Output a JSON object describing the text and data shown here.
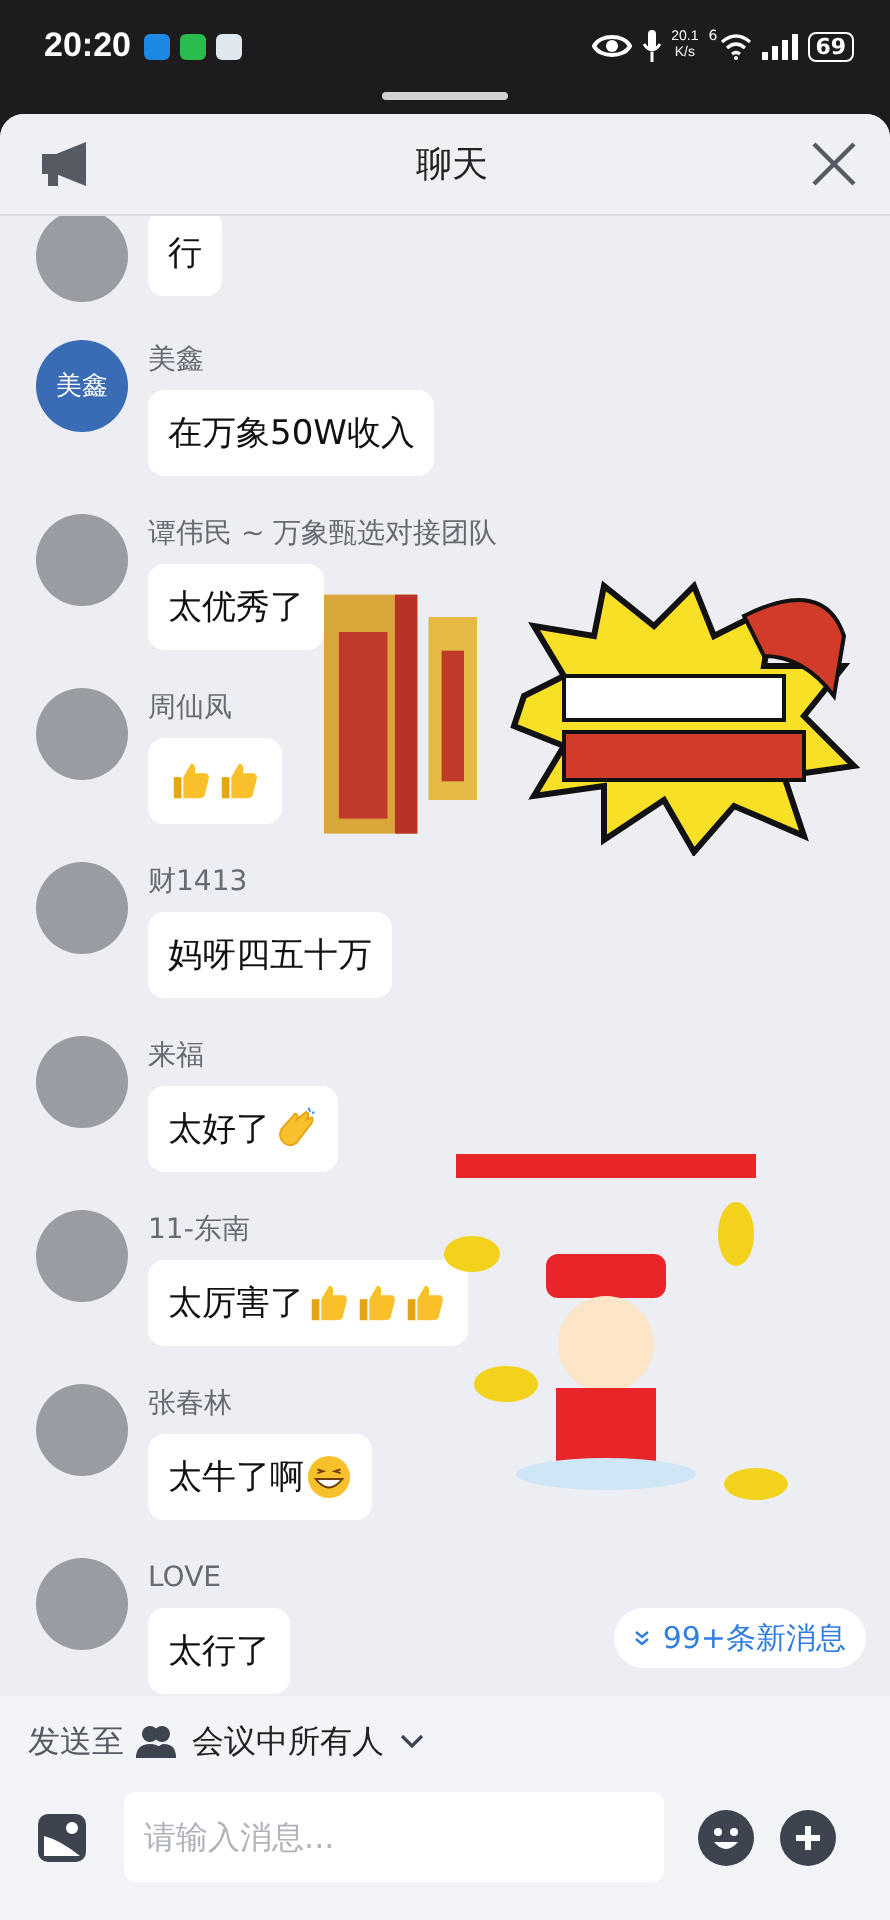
{
  "status_bar": {
    "time": "20:20",
    "net_speed_value": "20.1",
    "net_speed_unit": "K/s",
    "wifi_tag": "6",
    "battery": "69"
  },
  "header": {
    "title": "聊天"
  },
  "messages": [
    {
      "avatar": {
        "kind": "photo"
      },
      "text": "行"
    },
    {
      "sender": "美鑫",
      "avatar": {
        "kind": "initials",
        "text": "美鑫"
      },
      "text": "在万象50W收入"
    },
    {
      "sender": "谭伟民 ~ 万象甄选对接团队",
      "avatar": {
        "kind": "photo"
      },
      "text": "太优秀了"
    },
    {
      "sender": "周仙凤",
      "avatar": {
        "kind": "photo"
      },
      "emoji": [
        {
          "kind": "thumbs-up"
        },
        {
          "kind": "thumbs-up"
        }
      ]
    },
    {
      "sender": "财1413",
      "avatar": {
        "kind": "photo"
      },
      "text": "妈呀四五十万"
    },
    {
      "sender": "来福",
      "avatar": {
        "kind": "photo"
      },
      "text": "太好了",
      "emoji": [
        {
          "kind": "clap"
        }
      ]
    },
    {
      "sender": "11-东南",
      "avatar": {
        "kind": "photo"
      },
      "text": "太厉害了",
      "emoji": [
        {
          "kind": "thumbs-up"
        },
        {
          "kind": "thumbs-up"
        },
        {
          "kind": "thumbs-up"
        }
      ]
    },
    {
      "sender": "张春林",
      "avatar": {
        "kind": "photo"
      },
      "text": "太牛了啊",
      "emoji": [
        {
          "kind": "grin"
        }
      ]
    },
    {
      "sender": "LOVE",
      "avatar": {
        "kind": "photo"
      },
      "text": "太行了"
    }
  ],
  "new_messages": {
    "label": "99+条新消息"
  },
  "composer": {
    "send_to_label": "发送至",
    "recipient": "会议中所有人",
    "placeholder": "请输入消息..."
  }
}
